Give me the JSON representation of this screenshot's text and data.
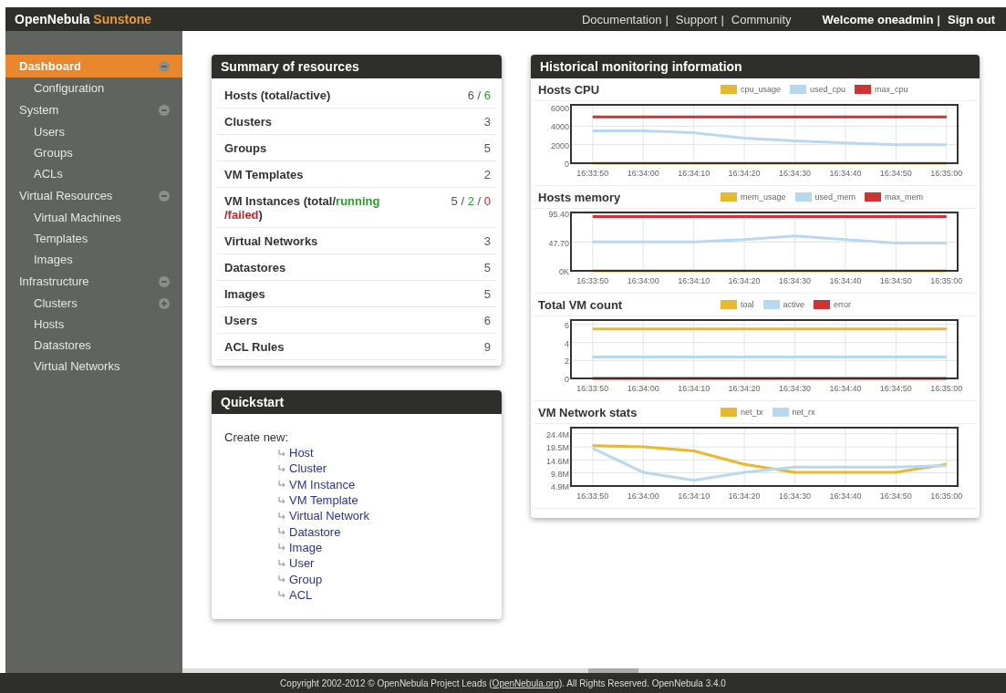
{
  "header": {
    "brand": [
      {
        "text": "OpenNebula",
        "kind": "main"
      },
      {
        "text": "Sunstone",
        "kind": "accent"
      }
    ],
    "links": [
      {
        "text": "Documentation",
        "kind": "link"
      },
      {
        "text": "|",
        "kind": "sep"
      },
      {
        "text": "Support",
        "kind": "link"
      },
      {
        "text": "|",
        "kind": "sep"
      },
      {
        "text": "Community",
        "kind": "link"
      }
    ],
    "user": [
      {
        "text": "Welcome oneadmin",
        "kind": "text"
      },
      {
        "text": "|",
        "kind": "sep"
      },
      {
        "text": "Sign out",
        "kind": "link"
      }
    ]
  },
  "sidebar": {
    "items": [
      {
        "label": "Dashboard",
        "selected": true,
        "expanded": true,
        "children": [
          {
            "label": "Configuration",
            "selected": false
          }
        ]
      },
      {
        "label": "System",
        "selected": false,
        "expanded": true,
        "children": [
          {
            "label": "Users",
            "selected": false
          },
          {
            "label": "Groups",
            "selected": false
          },
          {
            "label": "ACLs",
            "selected": false
          }
        ]
      },
      {
        "label": "Virtual Resources",
        "selected": false,
        "expanded": true,
        "children": [
          {
            "label": "Virtual Machines",
            "selected": false
          },
          {
            "label": "Templates",
            "selected": false
          },
          {
            "label": "Images",
            "selected": false
          }
        ]
      },
      {
        "label": "Infrastructure",
        "selected": false,
        "expanded": true,
        "children": [
          {
            "label": "Clusters",
            "selected": false,
            "expanded": false
          },
          {
            "label": "Hosts",
            "selected": false
          },
          {
            "label": "Datastores",
            "selected": false
          },
          {
            "label": "Virtual Networks",
            "selected": false
          }
        ]
      }
    ]
  },
  "summary": {
    "title": "Summary of resources",
    "rows": [
      {
        "label": [
          {
            "text": "Hosts (total/active)",
            "kind": "plain"
          }
        ],
        "value": [
          {
            "text": "6 / ",
            "kind": "plain"
          },
          {
            "text": "6",
            "kind": "ok"
          }
        ]
      },
      {
        "label": [
          {
            "text": "Clusters",
            "kind": "plain"
          }
        ],
        "value": [
          {
            "text": "3",
            "kind": "plain"
          }
        ]
      },
      {
        "label": [
          {
            "text": "Groups",
            "kind": "plain"
          }
        ],
        "value": [
          {
            "text": "5",
            "kind": "plain"
          }
        ]
      },
      {
        "label": [
          {
            "text": "VM Templates",
            "kind": "plain"
          }
        ],
        "value": [
          {
            "text": "2",
            "kind": "plain"
          }
        ]
      },
      {
        "label": [
          {
            "text": "VM Instances (total/",
            "kind": "plain"
          },
          {
            "text": "running",
            "kind": "ok"
          },
          {
            "text": " /failed",
            "kind": "error"
          },
          {
            "text": ")",
            "kind": "plain"
          }
        ],
        "value": [
          {
            "text": "5 / ",
            "kind": "plain"
          },
          {
            "text": "2",
            "kind": "ok"
          },
          {
            "text": " / ",
            "kind": "plain"
          },
          {
            "text": "0",
            "kind": "error"
          }
        ]
      },
      {
        "label": [
          {
            "text": "Virtual Networks",
            "kind": "plain"
          }
        ],
        "value": [
          {
            "text": "3",
            "kind": "plain"
          }
        ]
      },
      {
        "label": [
          {
            "text": "Datastores",
            "kind": "plain"
          }
        ],
        "value": [
          {
            "text": "5",
            "kind": "plain"
          }
        ]
      },
      {
        "label": [
          {
            "text": "Images",
            "kind": "plain"
          }
        ],
        "value": [
          {
            "text": "5",
            "kind": "plain"
          }
        ]
      },
      {
        "label": [
          {
            "text": "Users",
            "kind": "plain"
          }
        ],
        "value": [
          {
            "text": "6",
            "kind": "plain"
          }
        ]
      },
      {
        "label": [
          {
            "text": "ACL Rules",
            "kind": "plain"
          }
        ],
        "value": [
          {
            "text": "9",
            "kind": "plain"
          }
        ]
      }
    ]
  },
  "quickstart": {
    "title": "Quickstart",
    "intro": "Create new:",
    "links": [
      "Host",
      "Cluster",
      "VM Instance",
      "VM Template",
      "Virtual Network",
      "Datastore",
      "Image",
      "User",
      "Group",
      "ACL"
    ]
  },
  "monitoring": {
    "title": "Historical monitoring information",
    "charts": [
      {
        "title": "Hosts CPU",
        "chart_data": {
          "type": "line",
          "categories": [
            "16:33:50",
            "16:34:00",
            "16:34:10",
            "16:34:20",
            "16:34:30",
            "16:34:40",
            "16:34:50",
            "16:35:00"
          ],
          "ylim": [
            0,
            6300
          ],
          "grid": true,
          "yticks": [
            0,
            2000,
            4000,
            6000
          ],
          "series": [
            {
              "name": "cpu_usage",
              "color": "#e8b830",
              "values": [
                0,
                0,
                0,
                0,
                0,
                0,
                0,
                0
              ]
            },
            {
              "name": "used_cpu",
              "color": "#b8d8f0",
              "values": [
                3500,
                3500,
                3300,
                2700,
                2400,
                2200,
                2000,
                2000
              ]
            },
            {
              "name": "max_cpu",
              "color": "#cc3333",
              "values": [
                5000,
                5000,
                5000,
                5000,
                5000,
                5000,
                5000,
                5000
              ]
            }
          ]
        }
      },
      {
        "title": "Hosts memory",
        "chart_data": {
          "type": "line",
          "categories": [
            "16:33:50",
            "16:34:00",
            "16:34:10",
            "16:34:20",
            "16:34:30",
            "16:34:40",
            "16:34:50",
            "16:35:00"
          ],
          "ylim": [
            0,
            97
          ],
          "grid": true,
          "yticks": [
            {
              "value": 0,
              "label": "0K"
            },
            {
              "value": 47.7,
              "label": "47.70"
            },
            {
              "value": 95.4,
              "label": "95.40"
            }
          ],
          "series": [
            {
              "name": "mem_usage",
              "color": "#e8b830",
              "values": [
                0,
                0,
                0,
                0,
                0,
                0,
                0,
                0
              ]
            },
            {
              "name": "used_mem",
              "color": "#b8d8f0",
              "values": [
                48,
                48,
                48,
                52,
                58,
                52,
                46,
                46
              ]
            },
            {
              "name": "max_mem",
              "color": "#cc3333",
              "values": [
                90,
                90,
                90,
                90,
                90,
                90,
                90,
                90
              ]
            }
          ]
        }
      },
      {
        "title": "Total VM count",
        "chart_data": {
          "type": "line",
          "categories": [
            "16:33:50",
            "16:34:00",
            "16:34:10",
            "16:34:20",
            "16:34:30",
            "16:34:40",
            "16:34:50",
            "16:35:00"
          ],
          "ylim": [
            0,
            6.5
          ],
          "grid": true,
          "yticks": [
            0,
            2,
            4,
            6
          ],
          "series": [
            {
              "name": "toal",
              "color": "#e8b830",
              "values": [
                5.5,
                5.5,
                5.5,
                5.5,
                5.5,
                5.5,
                5.5,
                5.5
              ]
            },
            {
              "name": "active",
              "color": "#b8d8f0",
              "values": [
                2.4,
                2.4,
                2.4,
                2.4,
                2.4,
                2.4,
                2.4,
                2.4
              ]
            },
            {
              "name": "error",
              "color": "#cc3333",
              "values": [
                0,
                0,
                0,
                0,
                0,
                0,
                0,
                0
              ]
            }
          ]
        }
      },
      {
        "title": "VM Network stats",
        "chart_data": {
          "type": "line",
          "categories": [
            "16:33:50",
            "16:34:00",
            "16:34:10",
            "16:34:20",
            "16:34:30",
            "16:34:40",
            "16:34:50",
            "16:35:00"
          ],
          "ylim": [
            4.9,
            26.7
          ],
          "grid": true,
          "yticks": [
            {
              "value": 4.9,
              "label": "4.9M"
            },
            {
              "value": 9.8,
              "label": "9.8M"
            },
            {
              "value": 14.6,
              "label": "14.6M"
            },
            {
              "value": 19.5,
              "label": "19.5M"
            },
            {
              "value": 24.4,
              "label": "24.4M"
            }
          ],
          "series": [
            {
              "name": "net_tx",
              "color": "#e8b830",
              "values": [
                20,
                19.5,
                18,
                13,
                10,
                10,
                10,
                13
              ]
            },
            {
              "name": "net_rx",
              "color": "#b8d8f0",
              "values": [
                19,
                10,
                7,
                10,
                12,
                12,
                12,
                12.5
              ]
            }
          ]
        }
      }
    ]
  },
  "footer": {
    "before": "Copyright 2002-2012 © OpenNebula Project Leads (",
    "link": "OpenNebula.org",
    "after": "). All Rights Reserved. OpenNebula 3.4.0"
  }
}
